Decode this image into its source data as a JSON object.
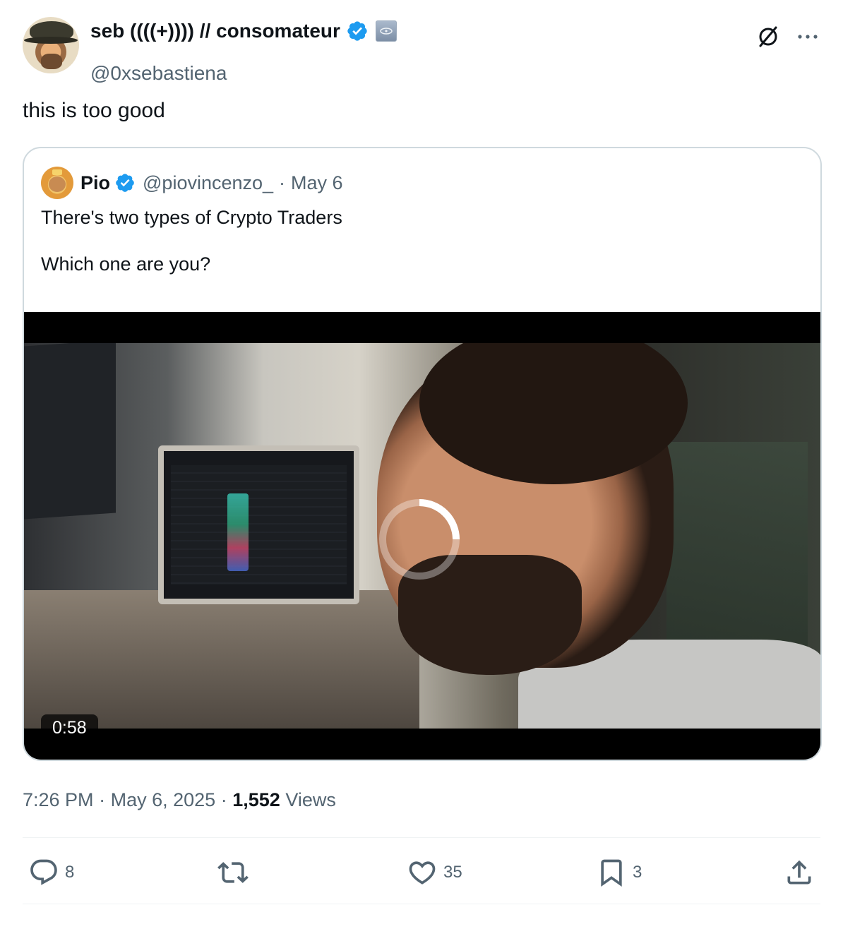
{
  "author": {
    "display_name": "seb ((((+)))) // consomateur",
    "handle": "@0xsebastiena"
  },
  "tweet": {
    "text": "this is too good"
  },
  "quoted_tweet": {
    "name": "Pio",
    "handle": "@piovincenzo_",
    "separator": "·",
    "date": "May 6",
    "text_line1": "There's two types of Crypto Traders",
    "text_line2": "Which one are you?",
    "video": {
      "duration": "0:58"
    }
  },
  "meta": {
    "time": "7:26 PM",
    "separator": "·",
    "date": "May 6, 2025",
    "views_count": "1,552",
    "views_label": "Views"
  },
  "actions": {
    "replies": "8",
    "reposts": "",
    "likes": "35",
    "bookmarks": "3"
  },
  "colors": {
    "verified_blue": "#1d9bf0",
    "secondary_text": "#536471",
    "primary_text": "#0f1419",
    "border": "#cfd9de"
  },
  "icons": {
    "reply": "reply-icon",
    "repost": "repost-icon",
    "like": "heart-icon",
    "bookmark": "bookmark-icon",
    "share": "share-icon",
    "grok": "grok-icon",
    "more": "more-icon",
    "verified": "verified-badge-icon",
    "loading": "loading-spinner-icon"
  }
}
